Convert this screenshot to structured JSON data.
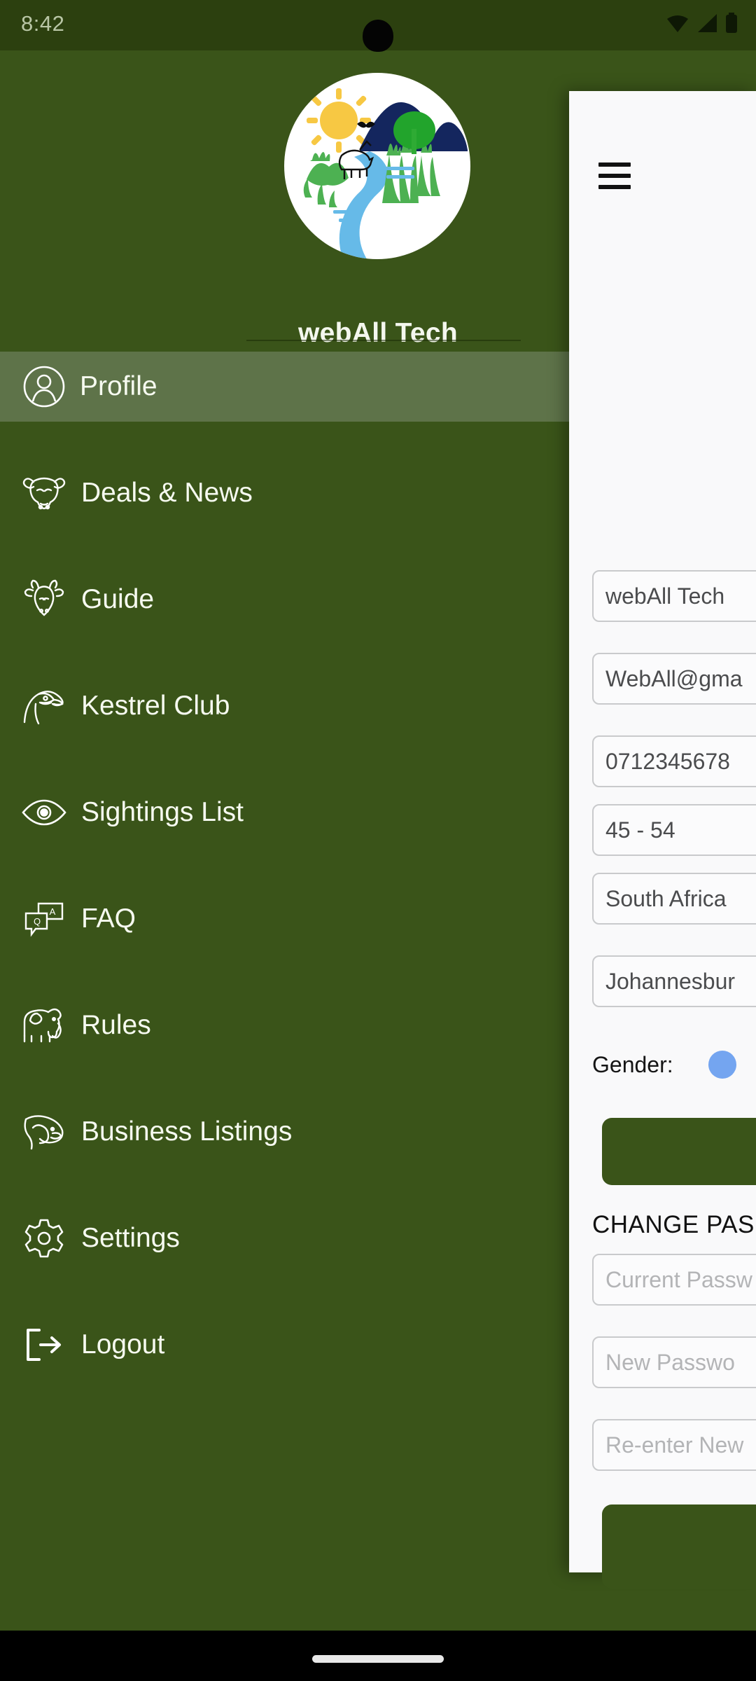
{
  "status_bar": {
    "time": "8:42",
    "icons": [
      "wifi-icon",
      "cellular-signal-icon",
      "battery-icon"
    ]
  },
  "drawer": {
    "logo": {
      "icon": "nature-landscape-logo",
      "elements": [
        "sun",
        "mountains",
        "river",
        "zebra",
        "bird",
        "tree",
        "grass"
      ],
      "colors": {
        "sun": "#f6c killer",
        "mountain": "#14265e",
        "river": "#63b9e9",
        "grass": "#4cb050",
        "tree": "#22a12a"
      }
    },
    "app_title": "webAll Tech",
    "items": [
      {
        "label": "Profile",
        "icon": "user-circle-icon",
        "selected": true
      },
      {
        "label": "Deals & News",
        "icon": "buffalo-head-icon",
        "selected": false
      },
      {
        "label": "Guide",
        "icon": "giraffe-head-icon",
        "selected": false
      },
      {
        "label": "Kestrel Club",
        "icon": "falcon-head-icon",
        "selected": false
      },
      {
        "label": "Sightings List",
        "icon": "eye-icon",
        "selected": false
      },
      {
        "label": "FAQ",
        "icon": "qa-speech-bubbles-icon",
        "selected": false
      },
      {
        "label": "Rules",
        "icon": "elephant-icon",
        "selected": false
      },
      {
        "label": "Business Listings",
        "icon": "rhino-head-icon",
        "selected": false
      },
      {
        "label": "Settings",
        "icon": "gear-icon",
        "selected": false
      },
      {
        "label": "Logout",
        "icon": "logout-arrow-icon",
        "selected": false
      }
    ]
  },
  "content_panel": {
    "menu_button_icon": "hamburger-menu-icon",
    "profile_fields": [
      {
        "name": "full-name",
        "value": "webAll Tech",
        "is_placeholder": false
      },
      {
        "name": "email",
        "value": "WebAll@gma",
        "is_placeholder": false
      },
      {
        "name": "phone",
        "value": "0712345678",
        "is_placeholder": false
      },
      {
        "name": "age-range",
        "value": "45 - 54",
        "is_placeholder": false
      },
      {
        "name": "country",
        "value": "South Africa",
        "is_placeholder": false
      },
      {
        "name": "city",
        "value": "Johannesbur",
        "is_placeholder": false
      }
    ],
    "gender": {
      "label": "Gender:",
      "selected_color": "#74a5f0"
    },
    "save_button": {
      "label": "",
      "color": "#3a5419"
    },
    "change_password": {
      "title": "CHANGE PAS",
      "fields": [
        {
          "name": "current-password",
          "value": "Current Passw",
          "is_placeholder": true
        },
        {
          "name": "new-password",
          "value": "New Passwo",
          "is_placeholder": true
        },
        {
          "name": "confirm-password",
          "value": "Re-enter New",
          "is_placeholder": true
        }
      ],
      "submit_button": {
        "label": "",
        "color": "#3a5419"
      }
    }
  },
  "nav_bar": {
    "gesture_pill": "home-gesture-indicator"
  }
}
